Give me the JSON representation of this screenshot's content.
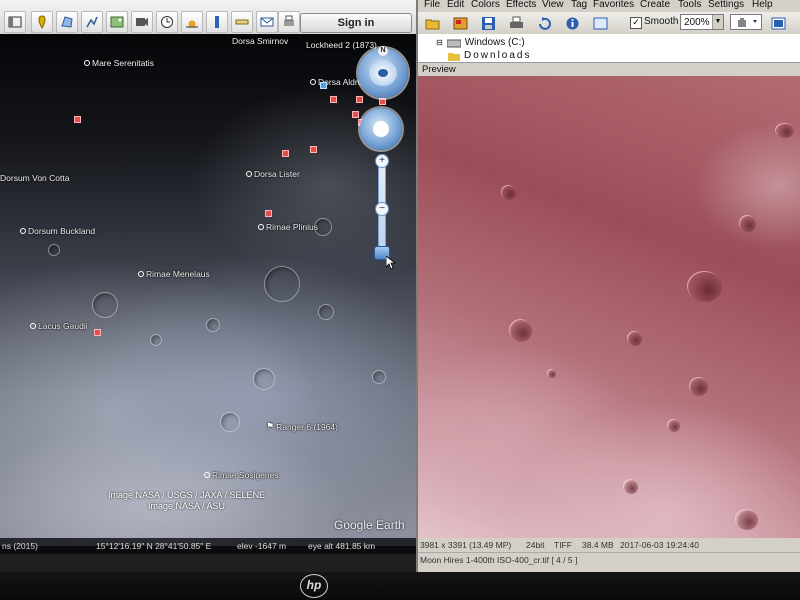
{
  "google_earth": {
    "toolbar": {
      "buttons": [
        "hide-sidebar",
        "placemark",
        "polygon",
        "path",
        "image-overlay",
        "record-tour",
        "historical-imagery",
        "sun",
        "planets",
        "ruler",
        "email",
        "print",
        "view-in-maps"
      ],
      "sign_in_label": "Sign in"
    },
    "places": [
      {
        "name": "Dorsa Smirnov"
      },
      {
        "name": "Mare Serenitatis"
      },
      {
        "name": "Lockheed 2 (1873)"
      },
      {
        "name": "Dorsa Aldrovandi"
      },
      {
        "name": "Dorsa Lister"
      },
      {
        "name": "Dorsum Von Cotta"
      },
      {
        "name": "Rimae Plinius"
      },
      {
        "name": "Dorsum Buckland"
      },
      {
        "name": "Rimae Menelaus"
      },
      {
        "name": "Lacus Gaudii"
      },
      {
        "name": "Ranger 6 (1964)"
      },
      {
        "name": "Rimae Sosigenes"
      }
    ],
    "credits": {
      "line1": "Image NASA / USGS / JAXA / SELENE",
      "line2": "Image NASA / ASU"
    },
    "logo": "Google Earth",
    "status": {
      "coords": "15°12'16.19\" N   28°41'50.85\" E",
      "elev": "elev -1647 m",
      "eye_alt": "eye alt 481.85 km",
      "left_text": "ns (2015)"
    }
  },
  "image_viewer": {
    "menu": [
      "File",
      "Edit",
      "Colors",
      "Effects",
      "View",
      "Tag",
      "Favorites",
      "Create",
      "Tools",
      "Settings",
      "Help"
    ],
    "toolbar": {
      "smooth_label": "Smooth",
      "smooth_checked": true,
      "zoom_value": "200%"
    },
    "tree": {
      "drive": "Windows (C:)",
      "folder": "Downloads"
    },
    "preview_label": "Preview",
    "status": {
      "dimensions": "3981 x 3391 (13.49 MP)",
      "bit_depth": "24bit",
      "format": "TIFF",
      "size": "38.4 MB",
      "date": "2017-06-03 19:24:40",
      "filename": "Moon Hires 1-400th ISO-400_cr.tif [ 4 / 5 ]"
    }
  },
  "bezel": {
    "brand": "hp"
  },
  "colors": {
    "ge_marker": "#e05050",
    "ge_nav": "#6e9bd0",
    "preview_tint": "#b46b72",
    "window_chrome": "#d4d0c8"
  }
}
